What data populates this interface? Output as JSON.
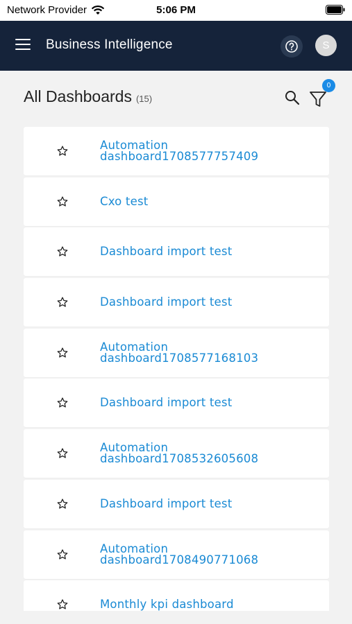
{
  "status_bar": {
    "carrier": "Network Provider",
    "time": "5:06 PM"
  },
  "header": {
    "menu_icon": "hamburger-icon",
    "title": "Business Intelligence",
    "help_icon": "help-circle-icon",
    "avatar_initial": "S"
  },
  "page": {
    "title": "All Dashboards",
    "count": "(15)",
    "search_icon": "search-icon",
    "filter_icon": "filter-icon",
    "filter_badge": "0"
  },
  "colors": {
    "header_bg": "#15233a",
    "link": "#1a8ad4",
    "badge": "#1a8be6",
    "page_bg": "#f2f2f2"
  },
  "dashboards": [
    {
      "title": "Automation dashboard1708577757409"
    },
    {
      "title": "Cxo test"
    },
    {
      "title": "Dashboard import test"
    },
    {
      "title": "Dashboard import test"
    },
    {
      "title": "Automation dashboard1708577168103"
    },
    {
      "title": "Dashboard import test"
    },
    {
      "title": "Automation dashboard1708532605608"
    },
    {
      "title": "Dashboard import test"
    },
    {
      "title": "Automation dashboard1708490771068"
    },
    {
      "title": "Monthly kpi dashboard"
    }
  ]
}
